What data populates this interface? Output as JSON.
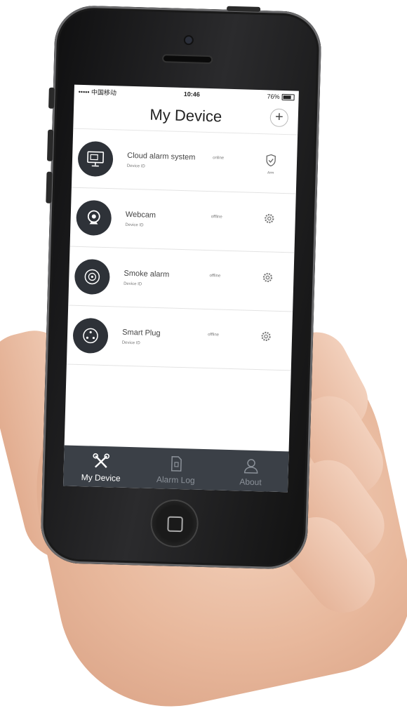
{
  "status_bar": {
    "carrier": "••••• 中国移动 ",
    "time": "10:46",
    "battery": "76%"
  },
  "header": {
    "title": "My Device",
    "add_label": "+"
  },
  "devices": [
    {
      "name": "Cloud alarm system",
      "id_label": "Device ID",
      "state": "online",
      "action_icon": "shield-icon",
      "action_label": "Arm"
    },
    {
      "name": "Webcam",
      "id_label": "Device ID",
      "state": "offline",
      "action_icon": "gear-icon"
    },
    {
      "name": "Smoke alarm",
      "id_label": "Device ID",
      "state": "offline",
      "action_icon": "gear-icon"
    },
    {
      "name": "Smart Plug",
      "id_label": "Device ID",
      "state": "offline",
      "action_icon": "gear-icon"
    }
  ],
  "tabs": [
    {
      "label": "My Device",
      "icon": "tools-icon",
      "active": true
    },
    {
      "label": "Alarm Log",
      "icon": "document-icon",
      "active": false
    },
    {
      "label": "About",
      "icon": "user-icon",
      "active": false
    }
  ],
  "colors": {
    "tab_bar": "#3b4047",
    "device_icon_bg": "#2e3238",
    "active_tab": "#ffffff",
    "inactive_tab": "#8b9199"
  }
}
